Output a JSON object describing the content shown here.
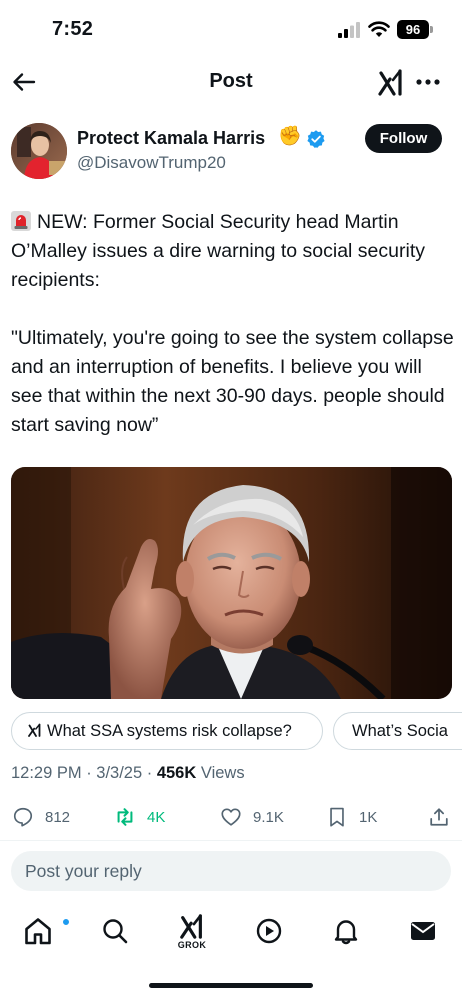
{
  "status_bar": {
    "time": "7:52",
    "battery": "96",
    "icons": [
      "signal-icon",
      "wifi-icon",
      "battery-icon"
    ]
  },
  "header": {
    "title": "Post",
    "icons": [
      "back-arrow-icon",
      "grok-icon",
      "more-icon"
    ]
  },
  "author": {
    "name": "Protect Kamala Harris",
    "emoji": "✊",
    "handle": "@DisavowTrump20",
    "verified": true,
    "follow_label": "Follow"
  },
  "post": {
    "paragraph_1": "NEW: Former Social Security head Martin O’Malley issues a dire warning to social security recipients:",
    "paragraph_2": "\"Ultimately, you're going to see the system collapse and an interruption of benefits. I believe you will see that within the next 30-90 days. people should start saving now”",
    "leading_icon": "siren-icon"
  },
  "grok_chips": [
    {
      "label": "What SSA systems risk collapse?",
      "icon": "grok-icon"
    },
    {
      "label": "What’s Socia",
      "icon": ""
    }
  ],
  "meta": {
    "timestamp": "12:29 PM · 3/3/25 · ",
    "views_count": "456K",
    "views_label": " Views"
  },
  "actions": {
    "replies": "812",
    "reposts": "4K",
    "likes": "9.1K",
    "bookmarks": "1K"
  },
  "reply": {
    "placeholder": "Post your reply"
  },
  "bottom_nav": {
    "items": [
      "home-icon",
      "search-icon",
      "grok-icon",
      "video-icon",
      "notifications-icon",
      "messages-icon"
    ],
    "grok_label": "GROK"
  },
  "colors": {
    "text": "#0f1419",
    "secondary": "#536471",
    "accent": "#1d9bf0",
    "repost": "#00ba7c"
  }
}
